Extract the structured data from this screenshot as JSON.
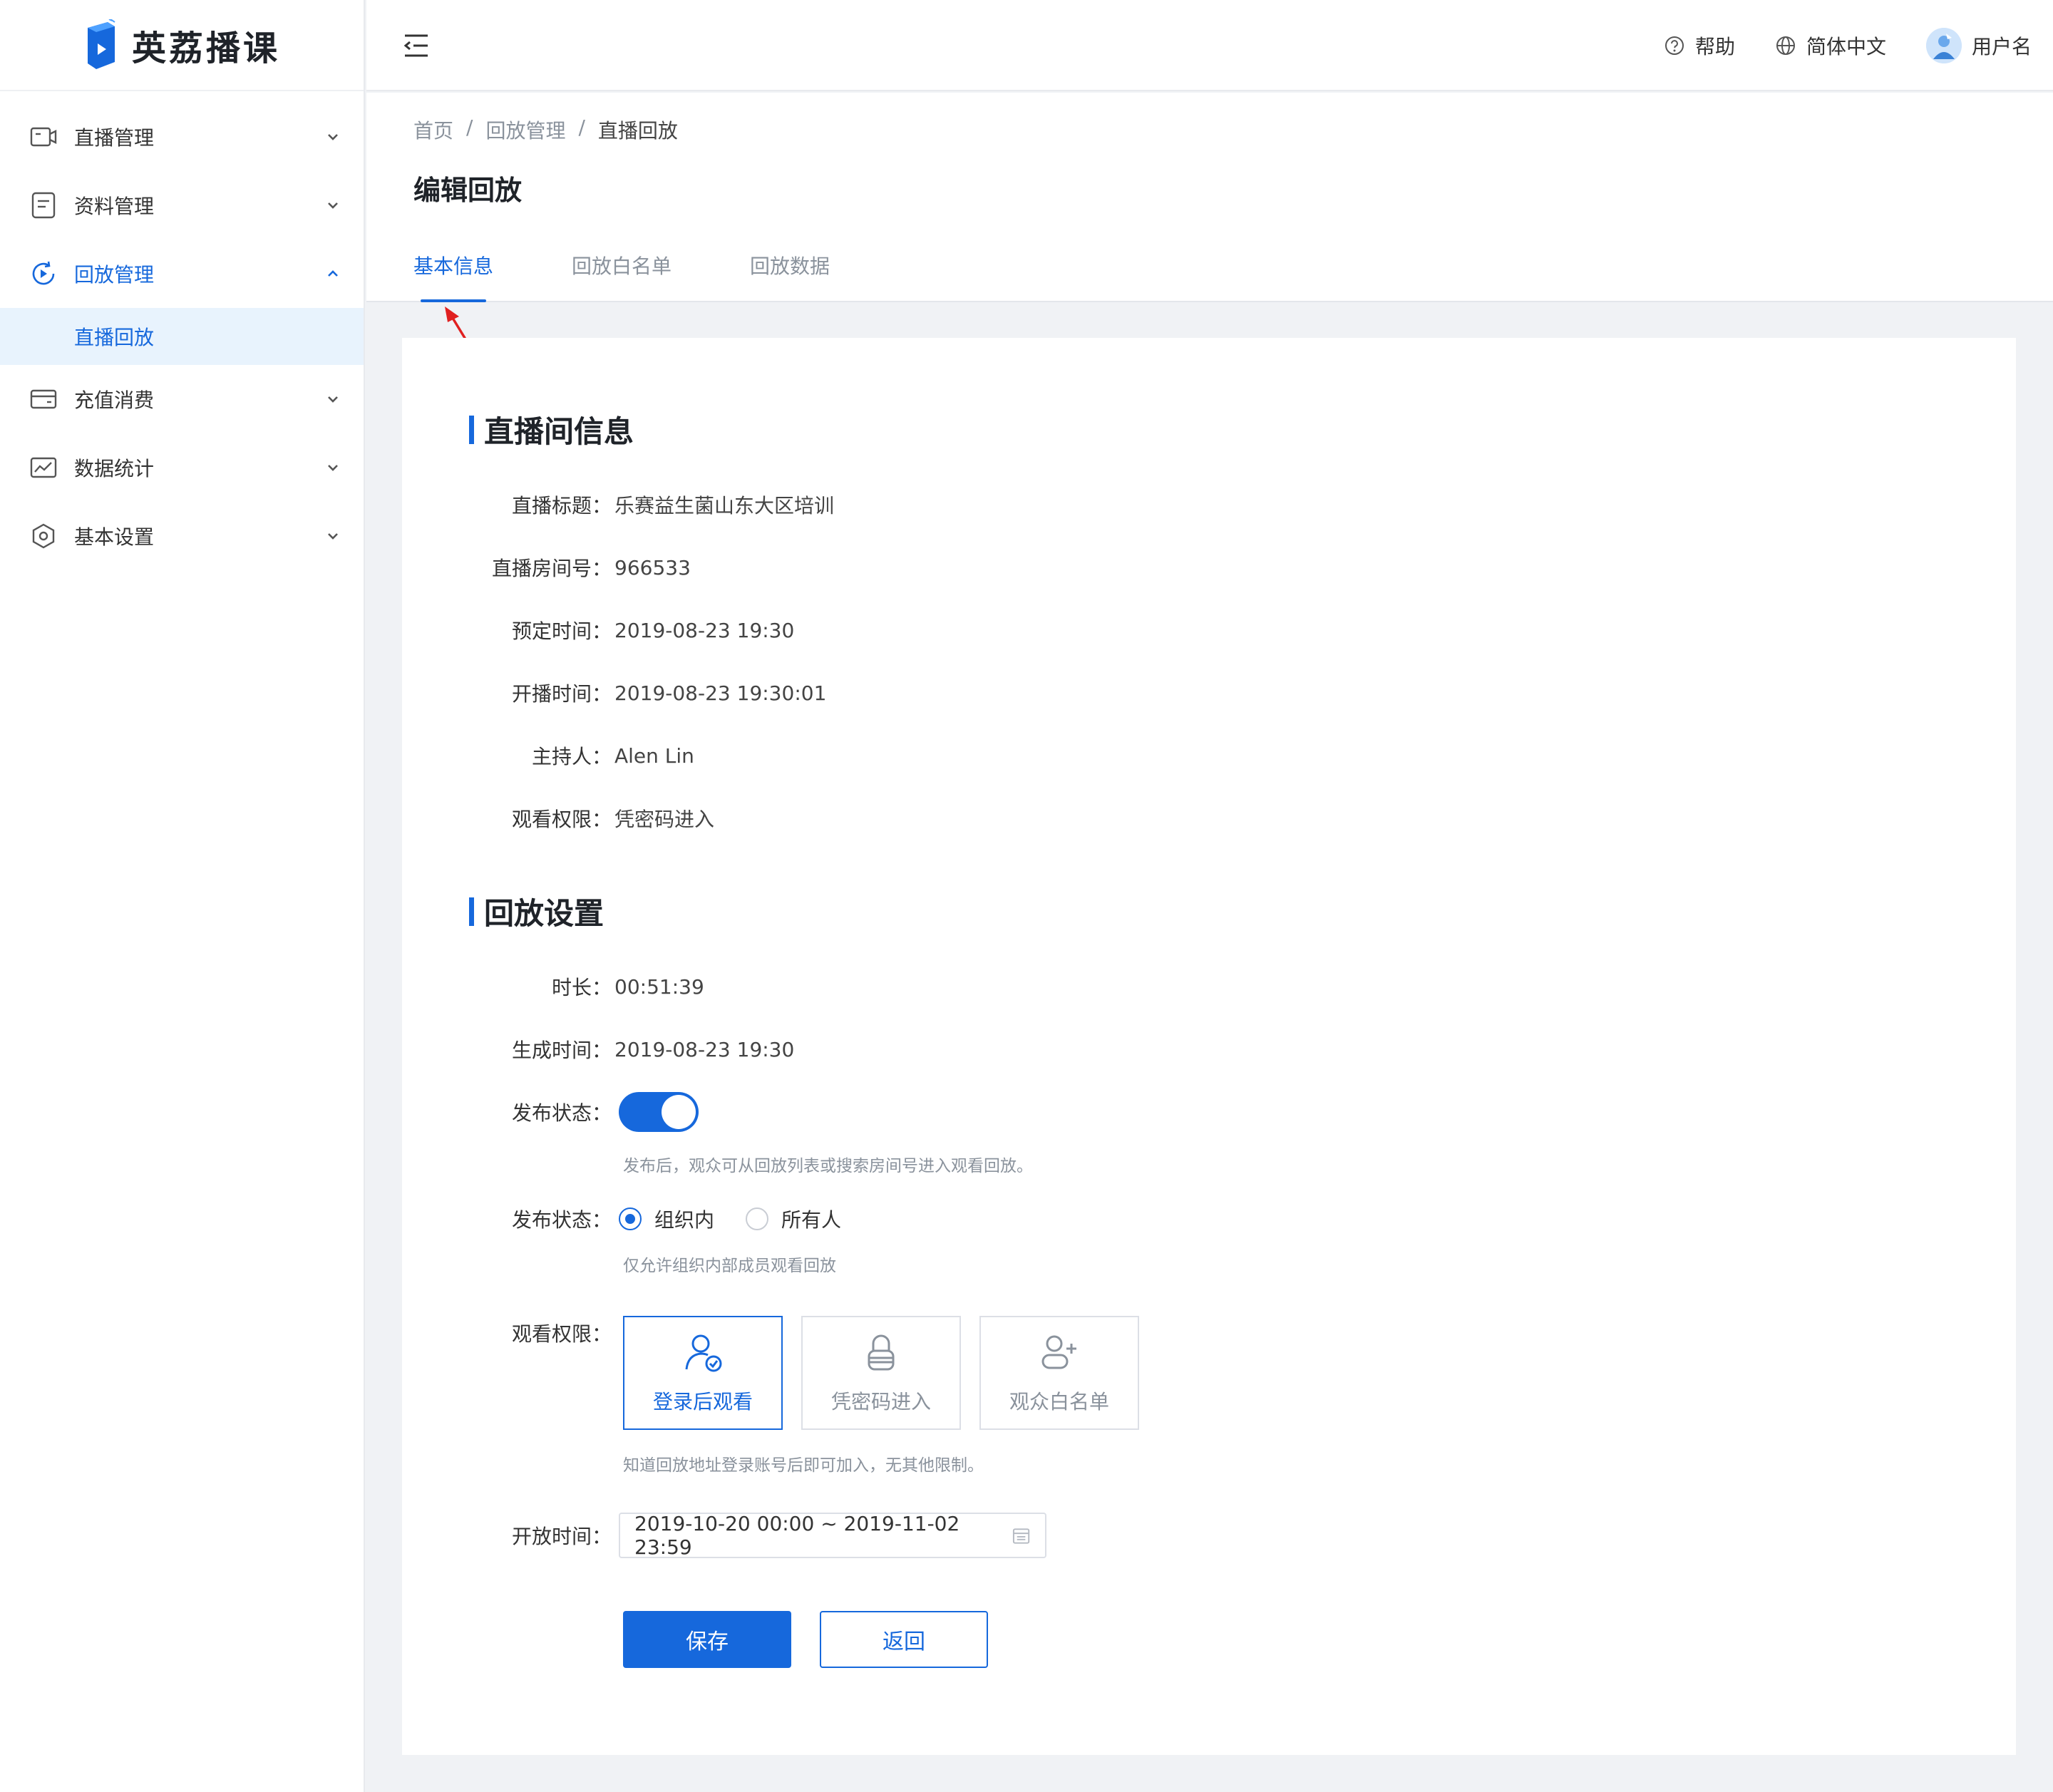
{
  "app": {
    "name": "英荔播课"
  },
  "sidebar": {
    "items": [
      {
        "label": "直播管理",
        "icon": "video-camera-icon"
      },
      {
        "label": "资料管理",
        "icon": "document-icon"
      },
      {
        "label": "回放管理",
        "icon": "replay-icon",
        "expanded": true
      },
      {
        "label": "充值消费",
        "icon": "wallet-icon"
      },
      {
        "label": "数据统计",
        "icon": "chart-icon"
      },
      {
        "label": "基本设置",
        "icon": "settings-icon"
      }
    ],
    "sub_item": "直播回放"
  },
  "topbar": {
    "help": "帮助",
    "language": "简体中文",
    "username": "用户名"
  },
  "breadcrumb": {
    "home": "首页",
    "parent": "回放管理",
    "current": "直播回放",
    "separator": "/"
  },
  "page_title": "编辑回放",
  "tabs": [
    {
      "label": "基本信息",
      "active": true
    },
    {
      "label": "回放白名单",
      "active": false
    },
    {
      "label": "回放数据",
      "active": false
    }
  ],
  "room_info": {
    "title": "直播间信息",
    "rows": [
      {
        "label": "直播标题：",
        "value": "乐赛益生菌山东大区培训"
      },
      {
        "label": "直播房间号：",
        "value": "966533"
      },
      {
        "label": "预定时间：",
        "value": "2019-08-23  19:30"
      },
      {
        "label": "开播时间：",
        "value": "2019-08-23 19:30:01"
      },
      {
        "label": "主持人：",
        "value": "Alen Lin"
      },
      {
        "label": "观看权限：",
        "value": "凭密码进入"
      }
    ]
  },
  "replay_settings": {
    "title": "回放设置",
    "duration": {
      "label": "时长：",
      "value": "00:51:39"
    },
    "created": {
      "label": "生成时间：",
      "value": "2019-08-23 19:30"
    },
    "publish": {
      "label": "发布状态：",
      "on": true,
      "hint": "发布后，观众可从回放列表或搜索房间号进入观看回放。"
    },
    "scope": {
      "label": "发布状态：",
      "options": [
        "组织内",
        "所有人"
      ],
      "selected": "组织内",
      "hint": "仅允许组织内部成员观看回放"
    },
    "permission": {
      "label": "观看权限：",
      "options": [
        "登录后观看",
        "凭密码进入",
        "观众白名单"
      ],
      "selected": "登录后观看",
      "hint": "知道回放地址登录账号后即可加入，无其他限制。"
    },
    "open_time": {
      "label": "开放时间：",
      "value": "2019-10-20 00:00 ~ 2019-11-02 23:59"
    }
  },
  "actions": {
    "save": "保存",
    "back": "返回"
  },
  "colors": {
    "primary": "#1668dc",
    "annotation": "#e02020"
  }
}
